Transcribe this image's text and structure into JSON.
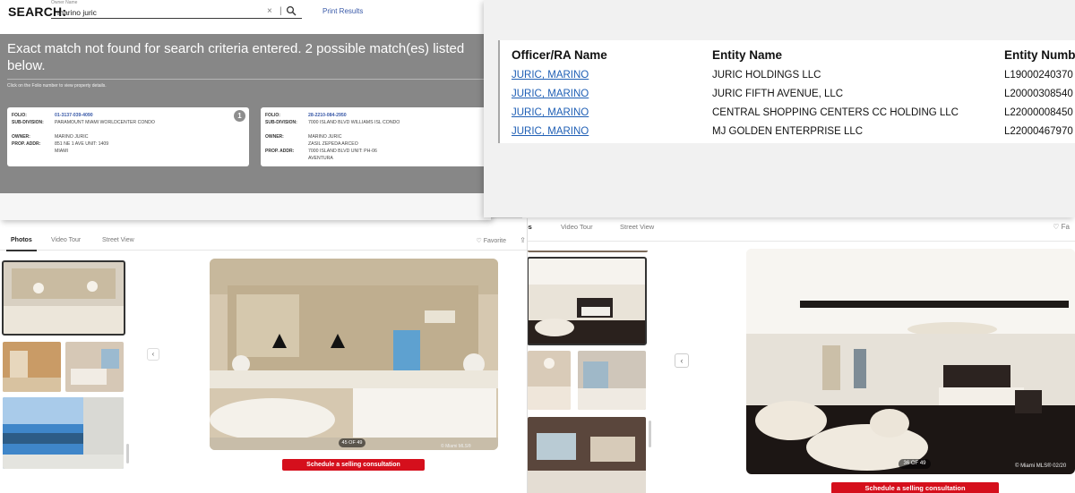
{
  "search_window": {
    "brand": "SEARCH:",
    "field_label": "Owner Name",
    "query": "marino juric",
    "clear_icon": "×",
    "separator": "|",
    "search_icon": "⚲",
    "print_results": "Print Results",
    "message": "Exact match not found for search criteria entered.   2 possible match(es) listed below.",
    "hint": "Click on the Folio number to view property details.",
    "results": [
      {
        "badge": "1",
        "folio_label": "FOLIO:",
        "folio": "01-3137-039-4090",
        "subdivision_label": "SUB-DIVISION:",
        "subdivision": "PARAMOUNT MIAMI WORLDCENTER CONDO",
        "owner_label": "OWNER:",
        "owner_lines": [
          "MARINO JURIC"
        ],
        "addr_label": "PROP. ADDR:",
        "addr_lines": [
          "851 NE 1 AVE     UNIT: 1409",
          "MIAMI"
        ]
      },
      {
        "badge": "",
        "folio_label": "FOLIO:",
        "folio": "28-2210-084-2950",
        "subdivision_label": "SUB-DIVISION:",
        "subdivision": "7000 ISLAND BLVD WILLIAMS ISL CONDO",
        "owner_label": "OWNER:",
        "owner_lines": [
          "MARINO JURIC",
          "ZASIL ZEPEDA ARCEO"
        ],
        "addr_label": "PROP. ADDR:",
        "addr_lines": [
          "7000 ISLAND BLVD     UNIT: PH-06",
          "AVENTURA"
        ]
      }
    ]
  },
  "officer_window": {
    "headers": [
      "Officer/RA Name",
      "Entity Name",
      "Entity Numb"
    ],
    "rows": [
      {
        "officer": "JURIC, MARINO",
        "entity": "JURIC HOLDINGS LLC",
        "number": "L19000240370"
      },
      {
        "officer": "JURIC, MARINO",
        "entity": "JURIC FIFTH AVENUE, LLC",
        "number": "L20000308540"
      },
      {
        "officer": "JURIC, MARINO",
        "entity": "CENTRAL SHOPPING CENTERS CC HOLDING LLC",
        "number": "L22000008450"
      },
      {
        "officer": "JURIC, MARINO",
        "entity": "MJ GOLDEN ENTERPRISE LLC",
        "number": "L22000467970"
      }
    ]
  },
  "listing_left": {
    "tabs": [
      "Photos",
      "Video Tour",
      "Street View"
    ],
    "favorite": "♡ Favorite",
    "share_icon": "⇪",
    "prev_icon": "‹",
    "counter": "45 OF 49",
    "copyright": "© Miami MLS®",
    "cta": "Schedule a selling consultation"
  },
  "listing_right": {
    "tabs": [
      "os",
      "Video Tour",
      "Street View"
    ],
    "favorite": "♡ Fa",
    "prev_icon": "‹",
    "counter": "36 OF 49",
    "copyright": "© Miami MLS® 02/20",
    "cta": "Schedule a selling consultation"
  },
  "colors": {
    "link": "#1f5fb5",
    "cta_red": "#d50f1c",
    "panel_gray": "#878787",
    "folio_blue": "#3a5aa8"
  }
}
